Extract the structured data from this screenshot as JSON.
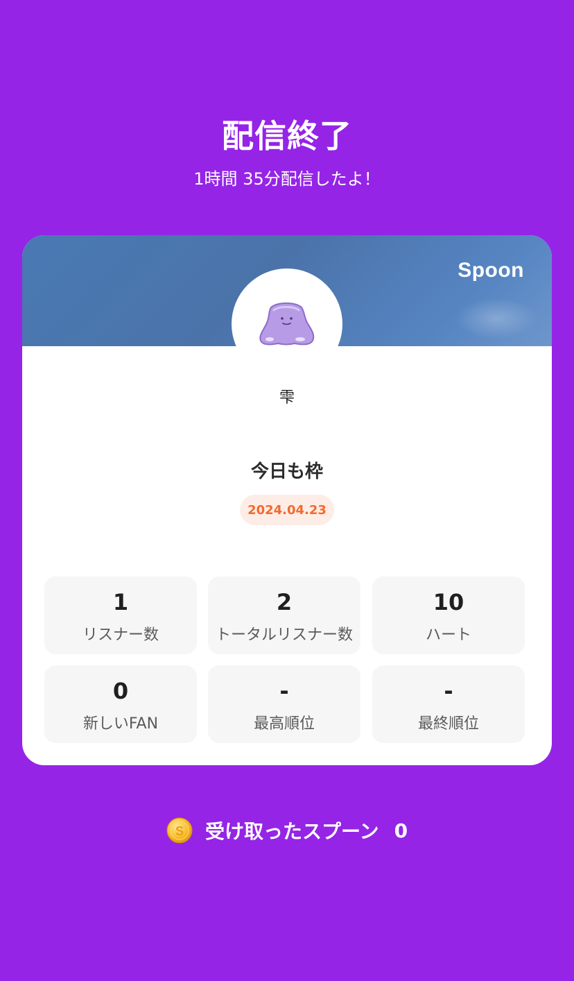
{
  "header": {
    "title": "配信終了",
    "subtitle": "1時間 35分配信したよ！"
  },
  "card": {
    "brand": "Spoon",
    "avatar_icon": "slime-character-icon",
    "username": "雫",
    "stream_title": "今日も枠",
    "date": "2024.04.23",
    "stats": [
      {
        "value": "1",
        "label": "リスナー数"
      },
      {
        "value": "2",
        "label": "トータルリスナー数"
      },
      {
        "value": "10",
        "label": "ハート"
      },
      {
        "value": "0",
        "label": "新しいFAN"
      },
      {
        "value": "-",
        "label": "最高順位"
      },
      {
        "value": "-",
        "label": "最終順位"
      }
    ]
  },
  "footer": {
    "spoon_label": "受け取ったスプーン",
    "spoon_count": "0",
    "coin_icon": "spoon-coin-icon"
  },
  "colors": {
    "background": "#9524E6",
    "date_text": "#F26A2E",
    "date_bg": "#FDEDE6",
    "stat_bg": "#F6F6F6"
  }
}
